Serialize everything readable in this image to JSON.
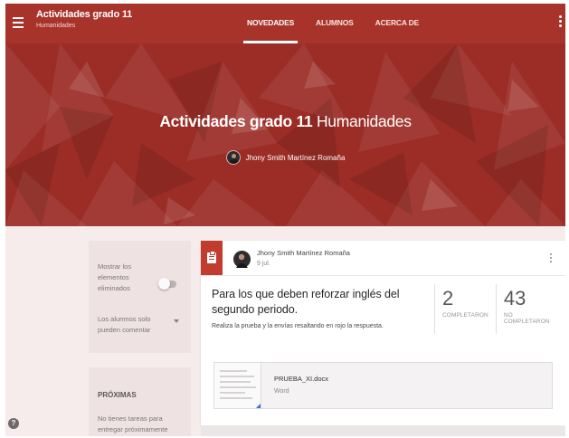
{
  "appbar": {
    "title": "Actividades grado 11",
    "subtitle": "Humanidades",
    "tabs": [
      {
        "label": "NOVEDADES",
        "active": true
      },
      {
        "label": "ALUMNOS",
        "active": false
      },
      {
        "label": "ACERCA DE",
        "active": false
      }
    ],
    "color": "#a8332a"
  },
  "banner": {
    "title_bold": "Actividades grado 11",
    "title_light": "Humanidades",
    "teacher": "Jhony Smith Martínez Romaña",
    "color": "#9b2d26"
  },
  "sidebar": {
    "show_deleted_label": "Mostrar los elementos eliminados",
    "show_deleted_on": false,
    "permission_value": "Los alumnos solo pueden comentar",
    "upcoming_title": "PRÓXIMAS",
    "upcoming_text": "No tienes tareas para entregar próximamente"
  },
  "post": {
    "author": "Jhony Smith Martínez Romaña",
    "date": "9 jul.",
    "title": "Para los que deben reforzar inglés del segundo periodo.",
    "description": "Realiza la prueba y la envías resaltando en rojo la respuesta.",
    "stats": [
      {
        "value": "2",
        "label": "COMPLETARON"
      },
      {
        "value": "43",
        "label": "NO COMPLETARON"
      }
    ],
    "attachment": {
      "name": "PRUEBA_XI.docx",
      "type": "Word"
    },
    "accent": "#c23b2f"
  },
  "icons": {
    "menu": "menu-icon",
    "more": "more-vert-icon",
    "assignment": "assignment-icon",
    "help": "help-icon"
  },
  "help_label": "?"
}
